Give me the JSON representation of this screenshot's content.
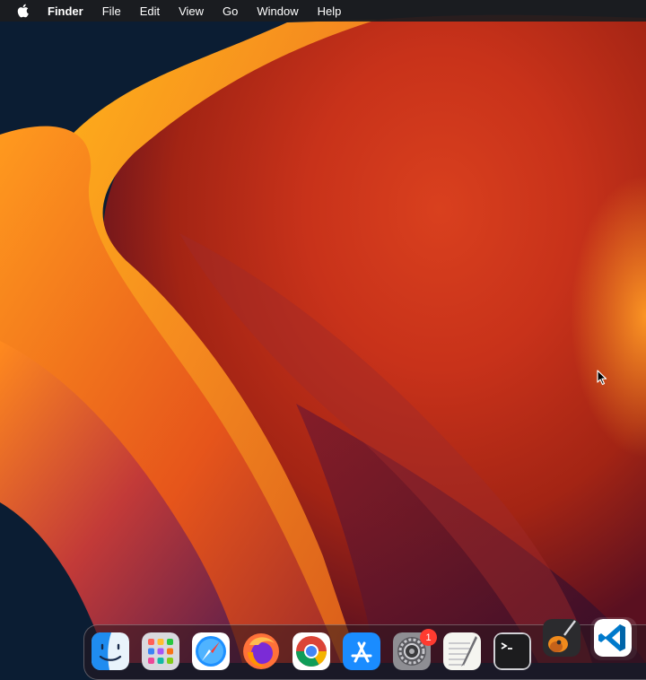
{
  "menubar": {
    "apple_icon": "apple-logo-icon",
    "items": [
      {
        "label": "Finder",
        "bold": true
      },
      {
        "label": "File"
      },
      {
        "label": "Edit"
      },
      {
        "label": "View"
      },
      {
        "label": "Go"
      },
      {
        "label": "Window"
      },
      {
        "label": "Help"
      }
    ]
  },
  "dock": {
    "apps": [
      {
        "icon": "finder-icon"
      },
      {
        "icon": "launchpad-icon"
      },
      {
        "icon": "safari-icon"
      },
      {
        "icon": "firefox-icon"
      },
      {
        "icon": "chrome-icon"
      },
      {
        "icon": "app-store-icon"
      },
      {
        "icon": "system-preferences-icon",
        "badge": "1"
      },
      {
        "icon": "textedit-icon"
      },
      {
        "icon": "terminal-icon"
      },
      {
        "icon": "garageband-icon"
      },
      {
        "icon": "vscode-icon"
      }
    ]
  },
  "colors": {
    "menubar_bg": "#1c1c1e",
    "badge": "#ff3b30",
    "wallpaper_orange": "#f7901e",
    "wallpaper_red": "#c8321a",
    "wallpaper_navy": "#0b1d33"
  }
}
